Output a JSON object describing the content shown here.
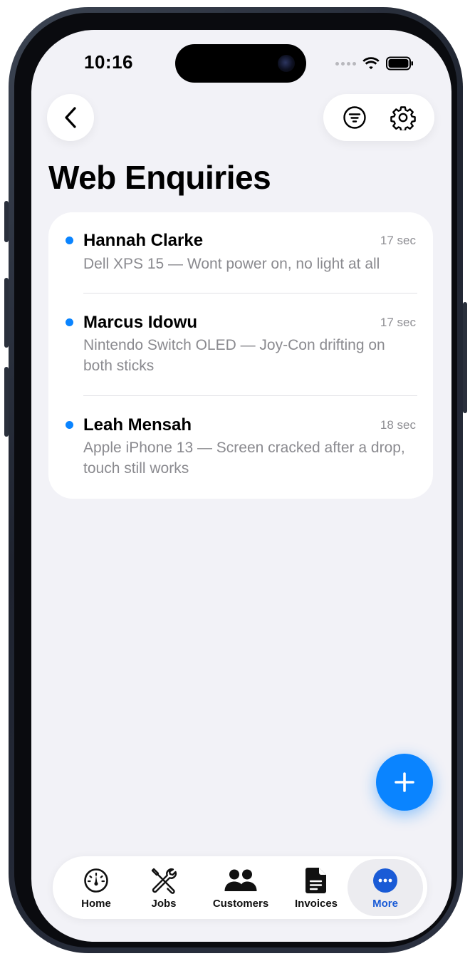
{
  "status_bar": {
    "time": "10:16"
  },
  "header": {
    "title": "Web Enquiries",
    "back_icon": "chevron-left-icon",
    "filter_icon": "filter-icon",
    "settings_icon": "gear-icon"
  },
  "enquiries": [
    {
      "name": "Hannah Clarke",
      "time": "17 sec",
      "description": "Dell XPS 15 — Wont power on, no light at all",
      "unread": true
    },
    {
      "name": "Marcus Idowu",
      "time": "17 sec",
      "description": "Nintendo Switch OLED — Joy-Con drifting on both sticks",
      "unread": true
    },
    {
      "name": "Leah Mensah",
      "time": "18 sec",
      "description": "Apple iPhone 13 — Screen cracked after a drop, touch still works",
      "unread": true
    }
  ],
  "fab": {
    "icon": "plus-icon"
  },
  "tabs": [
    {
      "label": "Home",
      "icon": "gauge-icon",
      "active": false
    },
    {
      "label": "Jobs",
      "icon": "tools-icon",
      "active": false
    },
    {
      "label": "Customers",
      "icon": "people-icon",
      "active": false
    },
    {
      "label": "Invoices",
      "icon": "document-icon",
      "active": false
    },
    {
      "label": "More",
      "icon": "more-icon",
      "active": true
    }
  ],
  "colors": {
    "accent": "#0a84ff",
    "unread_dot": "#0a84ff",
    "active_tab_label": "#1a5bd6",
    "background": "#f2f2f7"
  }
}
